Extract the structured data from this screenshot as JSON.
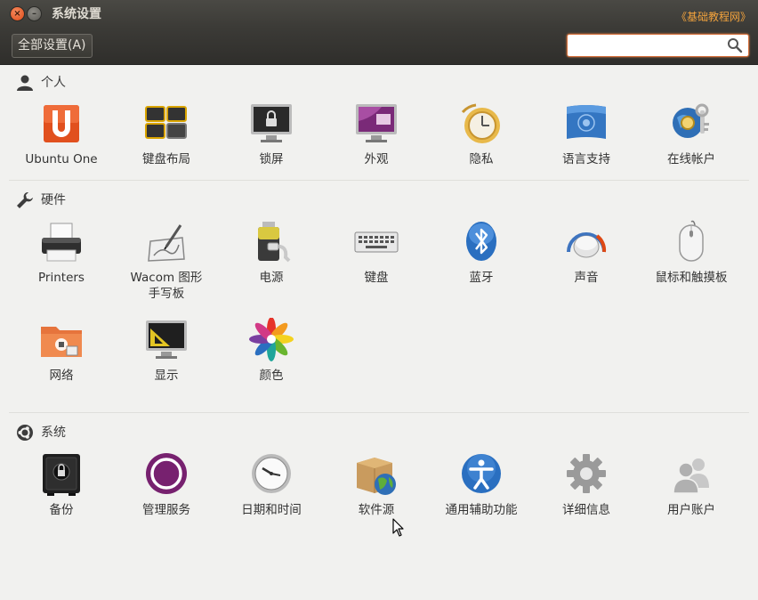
{
  "window": {
    "title": "系统设置",
    "watermark": "《基础教程网》",
    "close_glyph": "×",
    "minimize_glyph": "–"
  },
  "toolbar": {
    "all_settings_label": "全部设置(A)",
    "search_value": ""
  },
  "sections": {
    "personal": {
      "title": "个人",
      "icon": "person-icon"
    },
    "hardware": {
      "title": "硬件",
      "icon": "wrench-icon"
    },
    "system": {
      "title": "系统",
      "icon": "ubuntu-logo-icon"
    }
  },
  "items": {
    "ubuntu_one": {
      "label": "Ubuntu One",
      "icon": "ubuntu-one-icon"
    },
    "keyboard_layout": {
      "label": "键盘布局",
      "icon": "keyboard-layout-icon"
    },
    "lock_screen": {
      "label": "锁屏",
      "icon": "lock-screen-icon"
    },
    "appearance": {
      "label": "外观",
      "icon": "appearance-icon"
    },
    "privacy": {
      "label": "隐私",
      "icon": "privacy-icon"
    },
    "language_support": {
      "label": "语言支持",
      "icon": "language-support-icon"
    },
    "online_accounts": {
      "label": "在线帐户",
      "icon": "online-accounts-icon"
    },
    "printers": {
      "label": "Printers",
      "icon": "printer-icon"
    },
    "wacom": {
      "label": "Wacom 图形\n手写板",
      "icon": "wacom-tablet-icon"
    },
    "power": {
      "label": "电源",
      "icon": "power-icon"
    },
    "keyboard": {
      "label": "键盘",
      "icon": "keyboard-icon"
    },
    "bluetooth": {
      "label": "蓝牙",
      "icon": "bluetooth-icon"
    },
    "sound": {
      "label": "声音",
      "icon": "sound-icon"
    },
    "mouse": {
      "label": "鼠标和触摸板",
      "icon": "mouse-icon"
    },
    "network": {
      "label": "网络",
      "icon": "network-icon"
    },
    "display": {
      "label": "显示",
      "icon": "display-icon"
    },
    "color": {
      "label": "颜色",
      "icon": "color-icon"
    },
    "backup": {
      "label": "备份",
      "icon": "backup-icon"
    },
    "management": {
      "label": "管理服务",
      "icon": "management-service-icon"
    },
    "datetime": {
      "label": "日期和时间",
      "icon": "clock-icon"
    },
    "software_sources": {
      "label": "软件源",
      "icon": "software-sources-icon"
    },
    "accessibility": {
      "label": "通用辅助功能",
      "icon": "accessibility-icon"
    },
    "details": {
      "label": "详细信息",
      "icon": "gear-icon"
    },
    "user_accounts": {
      "label": "用户账户",
      "icon": "user-accounts-icon"
    }
  },
  "colors": {
    "ubuntu_orange": "#dd4814",
    "window_bg": "#f1f1ef",
    "titlebar": "#3c3b37"
  }
}
